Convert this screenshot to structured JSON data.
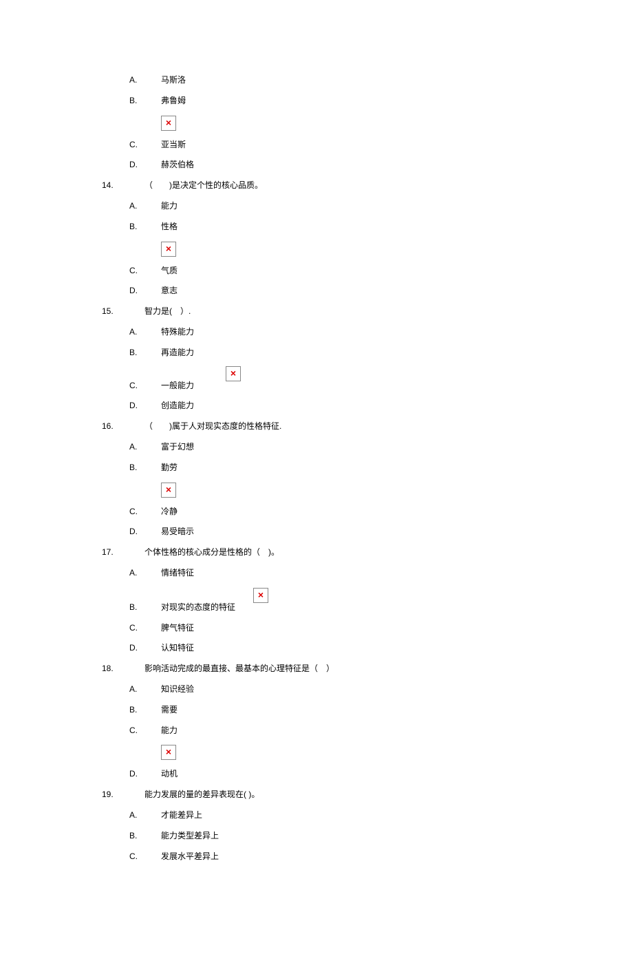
{
  "q13": {
    "options": {
      "A": {
        "letter": "A.",
        "text": "马斯洛"
      },
      "B": {
        "letter": "B.",
        "text": "弗鲁姆"
      },
      "C": {
        "letter": "C.",
        "text": "亚当斯"
      },
      "D": {
        "letter": "D.",
        "text": "赫茨伯格"
      }
    }
  },
  "q14": {
    "num": "14.",
    "text": "（　　)是决定个性的核心品质。",
    "options": {
      "A": {
        "letter": "A.",
        "text": "能力"
      },
      "B": {
        "letter": "B.",
        "text": "性格"
      },
      "C": {
        "letter": "C.",
        "text": "气质"
      },
      "D": {
        "letter": "D.",
        "text": "意志"
      }
    }
  },
  "q15": {
    "num": "15.",
    "text": "智力是(　）.",
    "options": {
      "A": {
        "letter": "A.",
        "text": "特殊能力"
      },
      "B": {
        "letter": "B.",
        "text": "再造能力"
      },
      "C": {
        "letter": "C.",
        "text": "一般能力"
      },
      "D": {
        "letter": "D.",
        "text": "创造能力"
      }
    }
  },
  "q16": {
    "num": "16.",
    "text": "（　　)属于人对现实态度的性格特征.",
    "options": {
      "A": {
        "letter": "A.",
        "text": "富于幻想"
      },
      "B": {
        "letter": "B.",
        "text": "勤劳"
      },
      "C": {
        "letter": "C.",
        "text": "冷静"
      },
      "D": {
        "letter": "D.",
        "text": "易受暗示"
      }
    }
  },
  "q17": {
    "num": "17.",
    "text": "个体性格的核心成分是性格的（　)。",
    "options": {
      "A": {
        "letter": "A.",
        "text": "情绪特征"
      },
      "B": {
        "letter": "B.",
        "text": "对现实的态度的特征"
      },
      "C": {
        "letter": "C.",
        "text": "脾气特征"
      },
      "D": {
        "letter": "D.",
        "text": "认知特征"
      }
    }
  },
  "q18": {
    "num": "18.",
    "text": "影响活动完成的最直接、最基本的心理特征是（　）",
    "options": {
      "A": {
        "letter": "A.",
        "text": "知识经验"
      },
      "B": {
        "letter": "B.",
        "text": "需要"
      },
      "C": {
        "letter": "C.",
        "text": "能力"
      },
      "D": {
        "letter": "D.",
        "text": "动机"
      }
    }
  },
  "q19": {
    "num": "19.",
    "text": "能力发展的量的差异表现在( )。",
    "options": {
      "A": {
        "letter": "A.",
        "text": "才能差异上"
      },
      "B": {
        "letter": "B.",
        "text": "能力类型差异上"
      },
      "C": {
        "letter": "C.",
        "text": "发展水平差异上"
      }
    }
  }
}
